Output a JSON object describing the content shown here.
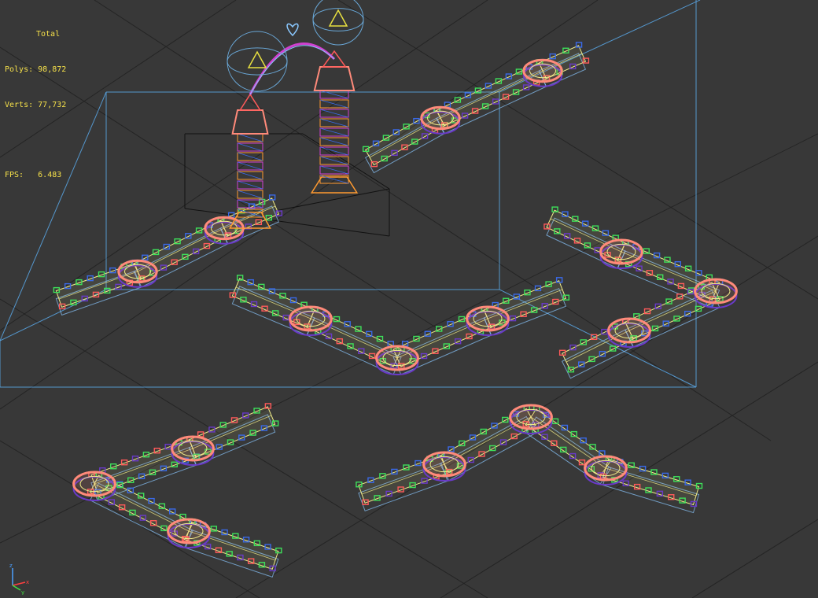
{
  "stats": {
    "title": "Total",
    "polys_label": "Polys:",
    "polys_value": "98,872",
    "verts_label": "Verts:",
    "verts_value": "77,732",
    "fps_label": "FPS:",
    "fps_value": "6.483"
  },
  "viewport": {
    "background": "#383838",
    "grid_color": "#242424",
    "bbox_color": "#5aa8e8",
    "text_color": "#f5e04a"
  },
  "palette": {
    "deck": "#f2ee8a",
    "rail_green": "#3ee05a",
    "rail_red": "#ff5a5a",
    "salmon": "#ff8a7a",
    "purple": "#6a3ac8",
    "blue": "#3a6ae8",
    "cyan": "#8ac8ff",
    "orange": "#ff9a30",
    "yellow": "#e8e040",
    "magenta": "#d040d0"
  },
  "axis_gizmo": {
    "x": "x",
    "y": "y",
    "z": "z"
  }
}
